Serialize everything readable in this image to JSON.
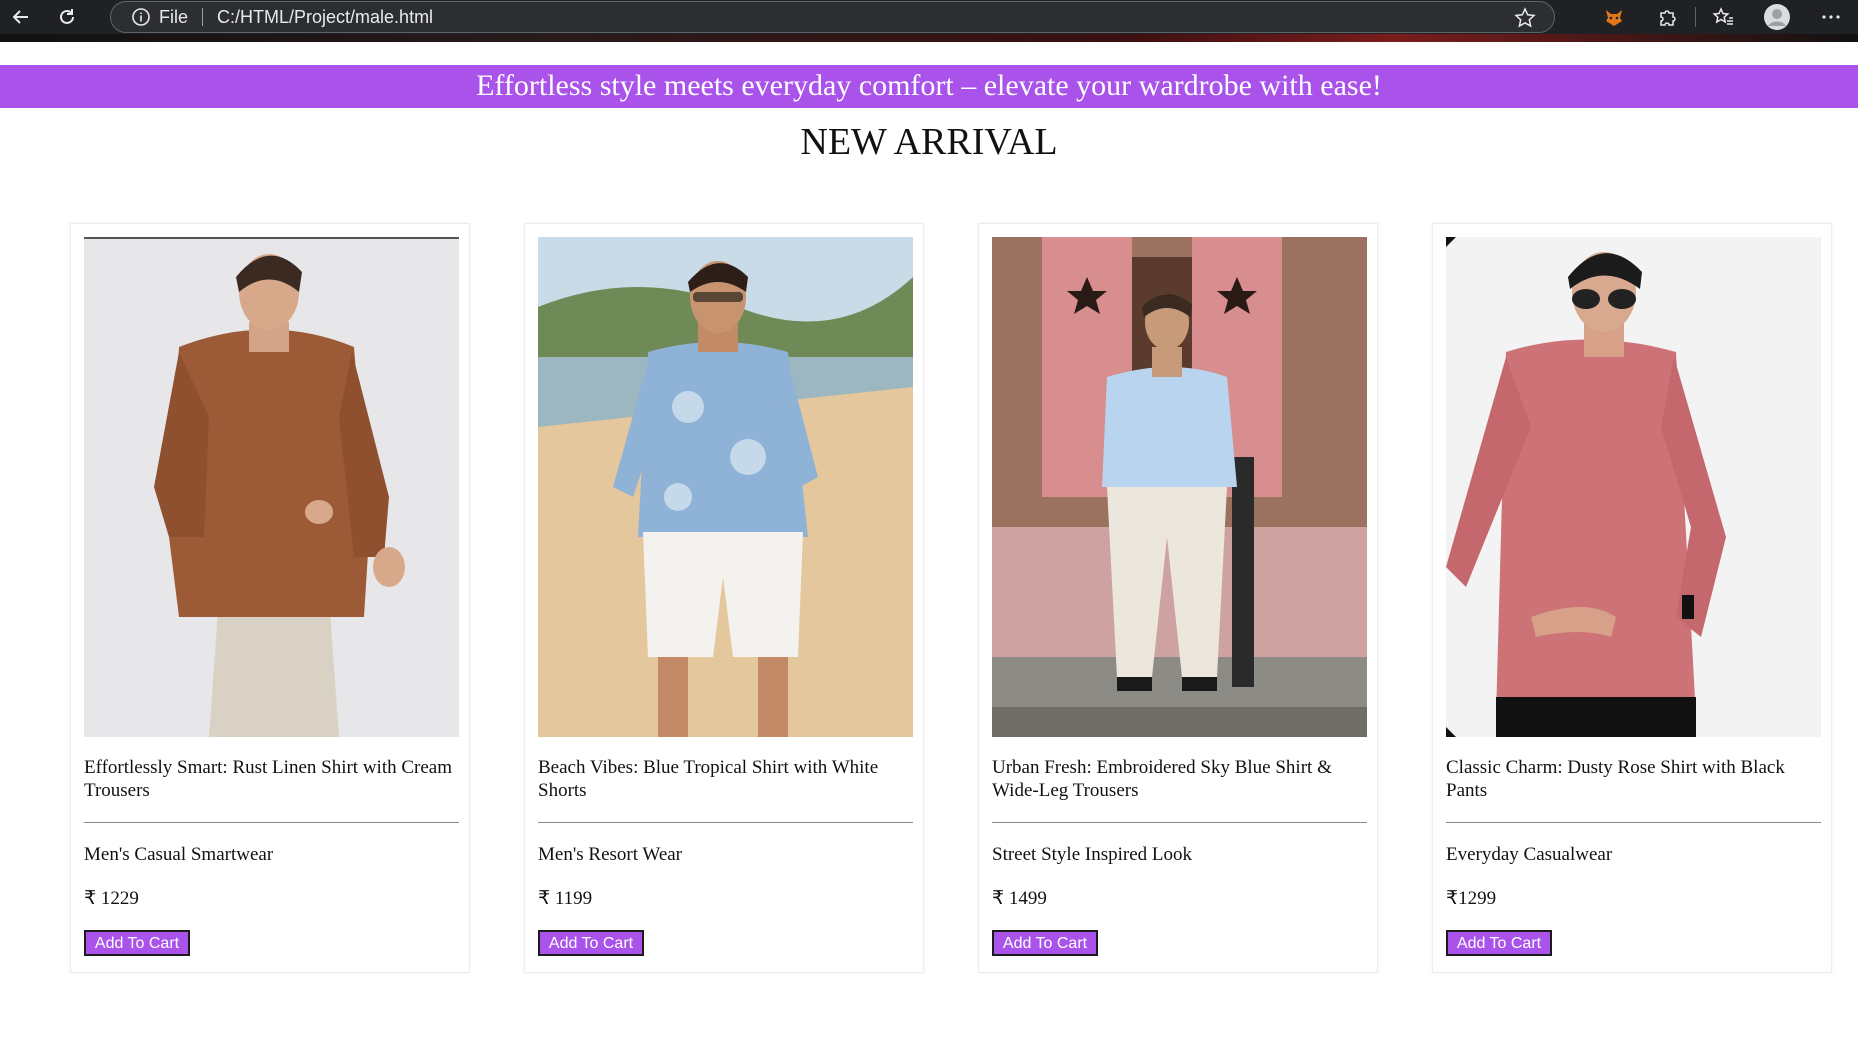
{
  "browser": {
    "protocol_label": "File",
    "url": "C:/HTML/Project/male.html"
  },
  "banner": {
    "text": "Effortless style meets everyday comfort – elevate your wardrobe with ease!"
  },
  "section": {
    "heading": "NEW ARRIVAL"
  },
  "products": [
    {
      "image_alt": "Man in rust linen shirt and cream trousers",
      "title": "Effortlessly Smart: Rust Linen Shirt with Cream Trousers",
      "category": "Men's Casual Smartwear",
      "price": "₹ 1229",
      "button_label": "Add To Cart"
    },
    {
      "image_alt": "Man in blue tropical shirt and white shorts on beach",
      "title": "Beach Vibes: Blue Tropical Shirt with White Shorts",
      "category": "Men's Resort Wear",
      "price": "₹ 1199",
      "button_label": "Add To Cart"
    },
    {
      "image_alt": "Man in embroidered sky blue shirt and wide-leg trousers",
      "title": "Urban Fresh: Embroidered Sky Blue Shirt & Wide-Leg Trousers",
      "category": "Street Style Inspired Look",
      "price": "₹ 1499",
      "button_label": "Add To Cart"
    },
    {
      "image_alt": "Man in dusty rose shirt with black pants",
      "title": "Classic Charm: Dusty Rose Shirt with Black Pants",
      "category": "Everyday Casualwear",
      "price": "₹1299",
      "button_label": "Add To Cart"
    }
  ],
  "colors": {
    "accent": "#a953ea",
    "chrome_bg": "#202124"
  },
  "icons": [
    "back-arrow-icon",
    "reload-icon",
    "info-icon",
    "star-icon",
    "fox-extension-icon",
    "puzzle-icon",
    "favorites-icon",
    "profile-icon",
    "more-icon"
  ]
}
